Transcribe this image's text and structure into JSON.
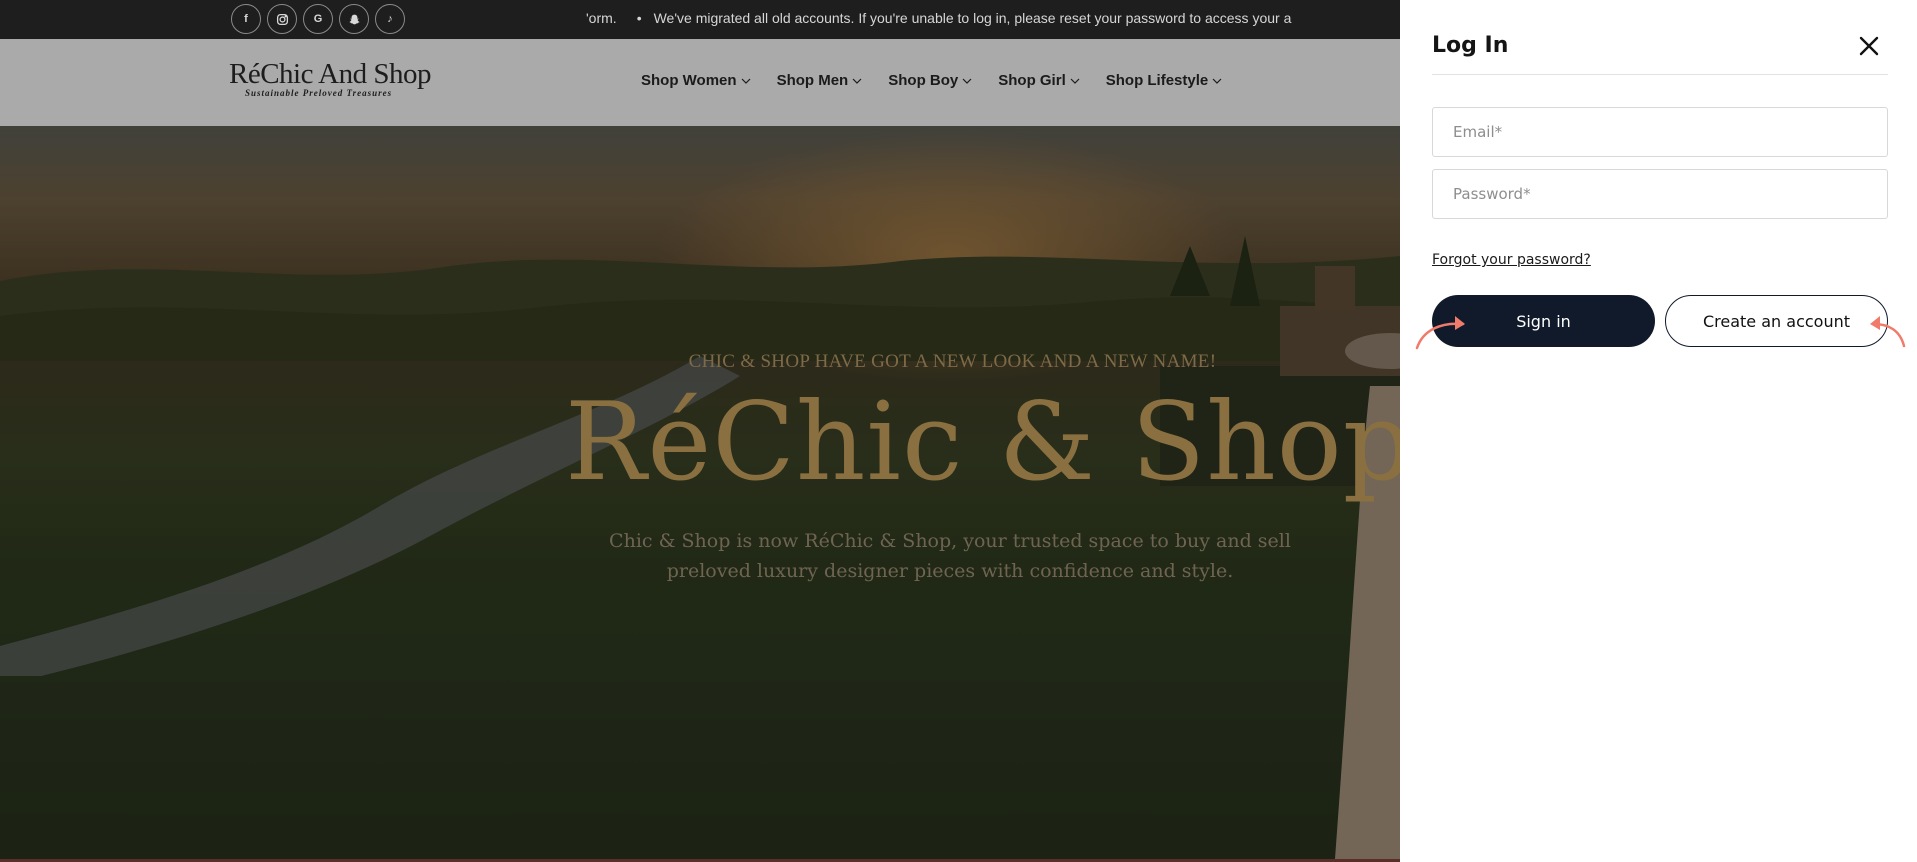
{
  "topbar": {
    "socials": [
      {
        "icon": "facebook-icon",
        "glyph": "f"
      },
      {
        "icon": "instagram-icon",
        "glyph": ""
      },
      {
        "icon": "google-icon",
        "glyph": "G"
      },
      {
        "icon": "snapchat-icon",
        "glyph": ""
      },
      {
        "icon": "tiktok-icon",
        "glyph": "♪"
      }
    ],
    "ticker_prefix": "'orm.",
    "ticker_message": "We've migrated all old accounts. If you're unable to log in, please reset your password to access your a"
  },
  "header": {
    "logo_main": "RéChic And Shop",
    "logo_sub": "Sustainable Preloved Treasures",
    "nav": [
      "Shop Women",
      "Shop Men",
      "Shop Boy",
      "Shop Girl",
      "Shop Lifestyle"
    ]
  },
  "hero": {
    "kicker": "CHIC & SHOP HAVE GOT A NEW LOOK AND A NEW NAME!",
    "title": "RéChic & Shop",
    "text": "Chic & Shop is now RéChic & Shop, your trusted space to buy and sell preloved luxury designer pieces with confidence and style."
  },
  "login": {
    "title": "Log In",
    "email_placeholder": "Email*",
    "password_placeholder": "Password*",
    "forgot_label": "Forgot your password?",
    "signin_label": "Sign in",
    "create_label": "Create an account"
  },
  "colors": {
    "topbar_bg": "#1e1e1e",
    "header_bg": "#aaaaaa",
    "primary_button": "#111a2b",
    "accent_arrows": "#f07b6b",
    "hero_title": "#8a7040"
  }
}
